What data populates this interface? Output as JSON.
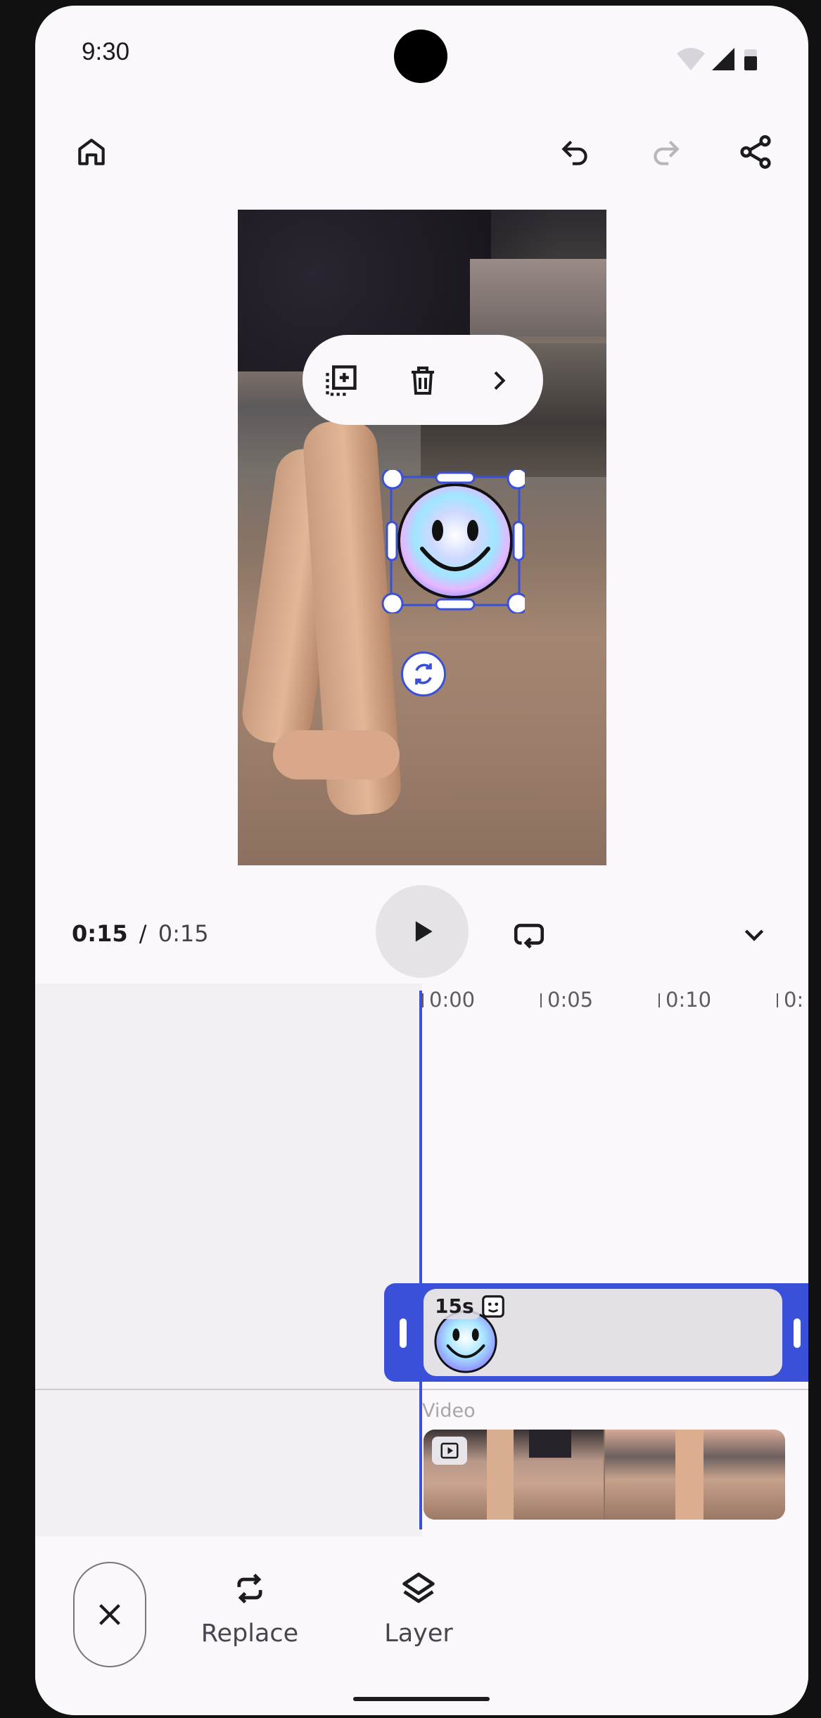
{
  "status": {
    "time": "9:30"
  },
  "header": {
    "home_icon": "home-icon",
    "undo_icon": "undo-icon",
    "redo_icon": "redo-icon",
    "share_icon": "share-icon"
  },
  "context_toolbar": {
    "duplicate_icon": "duplicate-icon",
    "delete_icon": "delete-icon",
    "more_icon": "chevron-right-icon"
  },
  "playback": {
    "current": "0:15",
    "separator": "/",
    "total": "0:15"
  },
  "timeline": {
    "ticks": [
      "0:00",
      "0:05",
      "0:10",
      "0:"
    ],
    "sticker_clip": {
      "duration": "15s"
    },
    "video_track_label": "Video"
  },
  "bottom_bar": {
    "replace_label": "Replace",
    "layer_label": "Layer"
  },
  "colors": {
    "accent": "#3a50d8",
    "background": "#fbf8fc",
    "text": "#1c1b1f"
  }
}
